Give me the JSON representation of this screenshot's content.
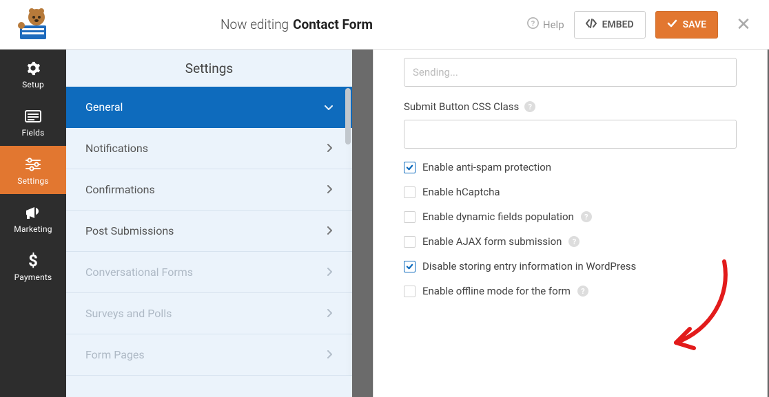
{
  "topbar": {
    "editing_prefix": "Now editing",
    "form_name": "Contact Form",
    "help_label": "Help",
    "embed_label": "EMBED",
    "save_label": "SAVE"
  },
  "nav": {
    "items": [
      {
        "label": "Setup",
        "icon": "gear-icon"
      },
      {
        "label": "Fields",
        "icon": "list-icon"
      },
      {
        "label": "Settings",
        "icon": "sliders-icon",
        "active": true
      },
      {
        "label": "Marketing",
        "icon": "bullhorn-icon"
      },
      {
        "label": "Payments",
        "icon": "dollar-icon"
      }
    ]
  },
  "settings": {
    "title": "Settings",
    "items": [
      {
        "label": "General",
        "active": true,
        "arrow": "down"
      },
      {
        "label": "Notifications",
        "active": false,
        "arrow": "right"
      },
      {
        "label": "Confirmations",
        "active": false,
        "arrow": "right"
      },
      {
        "label": "Post Submissions",
        "active": false,
        "arrow": "right"
      },
      {
        "label": "Conversational Forms",
        "active": false,
        "arrow": "right",
        "muted": true
      },
      {
        "label": "Surveys and Polls",
        "active": false,
        "arrow": "right",
        "muted": true
      },
      {
        "label": "Form Pages",
        "active": false,
        "arrow": "right",
        "muted": true
      }
    ]
  },
  "form": {
    "sending_placeholder": "Sending...",
    "css_class_label": "Submit Button CSS Class",
    "checkboxes": [
      {
        "label": "Enable anti-spam protection",
        "checked": true,
        "help": false
      },
      {
        "label": "Enable hCaptcha",
        "checked": false,
        "help": false
      },
      {
        "label": "Enable dynamic fields population",
        "checked": false,
        "help": true
      },
      {
        "label": "Enable AJAX form submission",
        "checked": false,
        "help": true
      },
      {
        "label": "Disable storing entry information in WordPress",
        "checked": true,
        "help": false
      },
      {
        "label": "Enable offline mode for the form",
        "checked": false,
        "help": true
      }
    ]
  },
  "colors": {
    "accent": "#e27730",
    "primary": "#0e6bbd",
    "annotation": "#e21b1b"
  }
}
